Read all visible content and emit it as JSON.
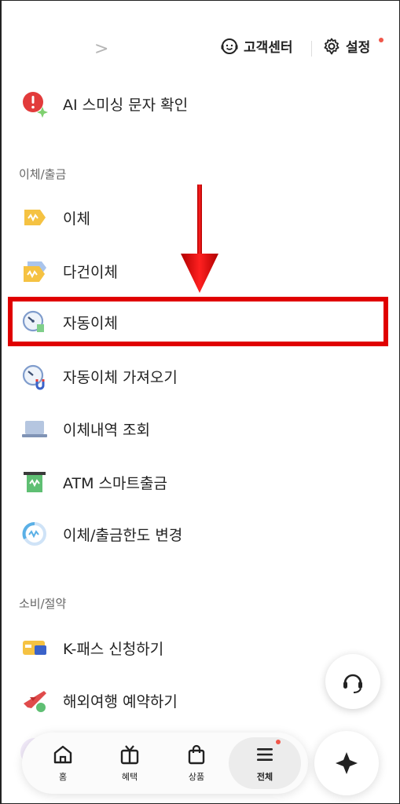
{
  "topbar": {
    "chevron": ">",
    "customer_center_label": "고객센터",
    "settings_label": "설정"
  },
  "menu": {
    "ai_check": "AI 스미싱 문자 확인",
    "section_transfer": "이체/출금",
    "items_transfer": [
      {
        "label": "이체",
        "icon": "transfer-icon"
      },
      {
        "label": "다건이체",
        "icon": "multi-transfer-icon"
      },
      {
        "label": "자동이체",
        "icon": "auto-transfer-icon"
      },
      {
        "label": "자동이체 가져오기",
        "icon": "auto-transfer-import-icon"
      },
      {
        "label": "이체내역 조회",
        "icon": "transfer-history-icon"
      },
      {
        "label": "ATM 스마트출금",
        "icon": "atm-icon"
      },
      {
        "label": "이체/출금한도 변경",
        "icon": "limit-change-icon"
      }
    ],
    "section_spending": "소비/절약",
    "items_spending": [
      {
        "label": "K-패스 신청하기",
        "icon": "kpass-icon"
      },
      {
        "label": "해외여행 예약하기",
        "icon": "airplane-icon"
      }
    ]
  },
  "bottom_nav": {
    "home": "홈",
    "benefits": "혜택",
    "products": "상품",
    "all": "전체"
  },
  "colors": {
    "highlight": "#e00000",
    "accent_yellow": "#f5c242",
    "badge_red": "#f0574a"
  }
}
